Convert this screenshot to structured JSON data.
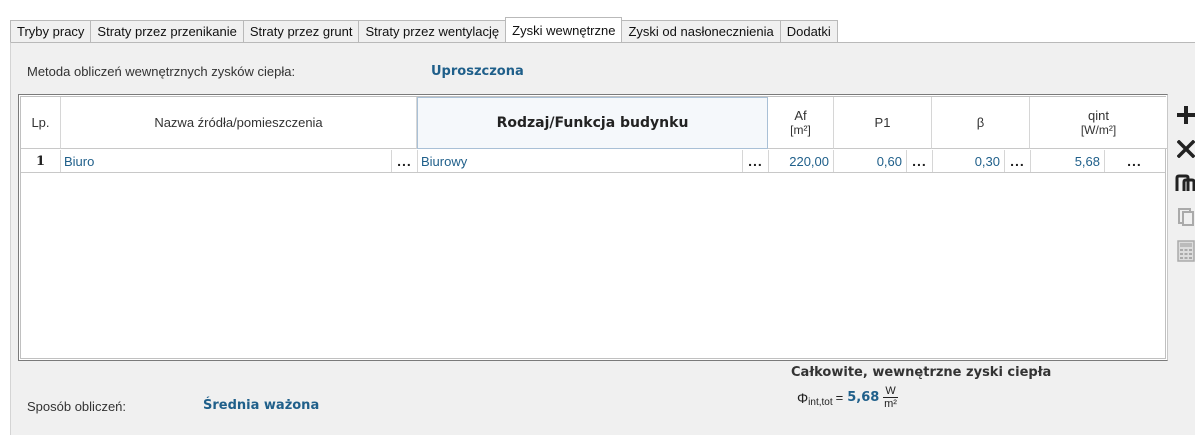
{
  "tabs": [
    {
      "label": "Tryby pracy",
      "active": false
    },
    {
      "label": "Straty przez przenikanie",
      "active": false
    },
    {
      "label": "Straty przez grunt",
      "active": false
    },
    {
      "label": "Straty przez wentylację",
      "active": false
    },
    {
      "label": "Zyski wewnętrzne",
      "active": true
    },
    {
      "label": "Zyski od nasłonecznienia",
      "active": false
    },
    {
      "label": "Dodatki",
      "active": false
    }
  ],
  "method": {
    "label": "Metoda obliczeń wewnętrznych zysków ciepła:",
    "value": "Uproszczona"
  },
  "table": {
    "headers": {
      "lp": "Lp.",
      "name": "Nazwa źródła/pomieszczenia",
      "type": "Rodzaj/Funkcja budynku",
      "af": "Af",
      "af_unit": "[m²]",
      "p1": "P1",
      "beta": "β",
      "qint": "qint",
      "qint_unit": "[W/m²]"
    },
    "rows": [
      {
        "lp": "1",
        "name": "Biuro",
        "type": "Biurowy",
        "af": "220,00",
        "p1": "0,60",
        "beta": "0,30",
        "qint": "5,68",
        "dots": "..."
      }
    ]
  },
  "toolbar": {
    "icons": [
      "plus-icon",
      "delete-icon",
      "copy-row-icon",
      "paste-icon",
      "calculator-icon"
    ]
  },
  "calc_mode": {
    "label": "Sposób obliczeń:",
    "value": "Średnia ważona"
  },
  "totals": {
    "title": "Całkowite, wewnętrzne zyski ciepła",
    "symbol": "Φ",
    "subscript": "int,tot",
    "equals": "=",
    "value": "5,68",
    "unit_numerator": "W",
    "unit_denominator": "m²"
  },
  "colors": {
    "accent": "#1f5f8a",
    "panel_bg": "#f0f0f0"
  }
}
